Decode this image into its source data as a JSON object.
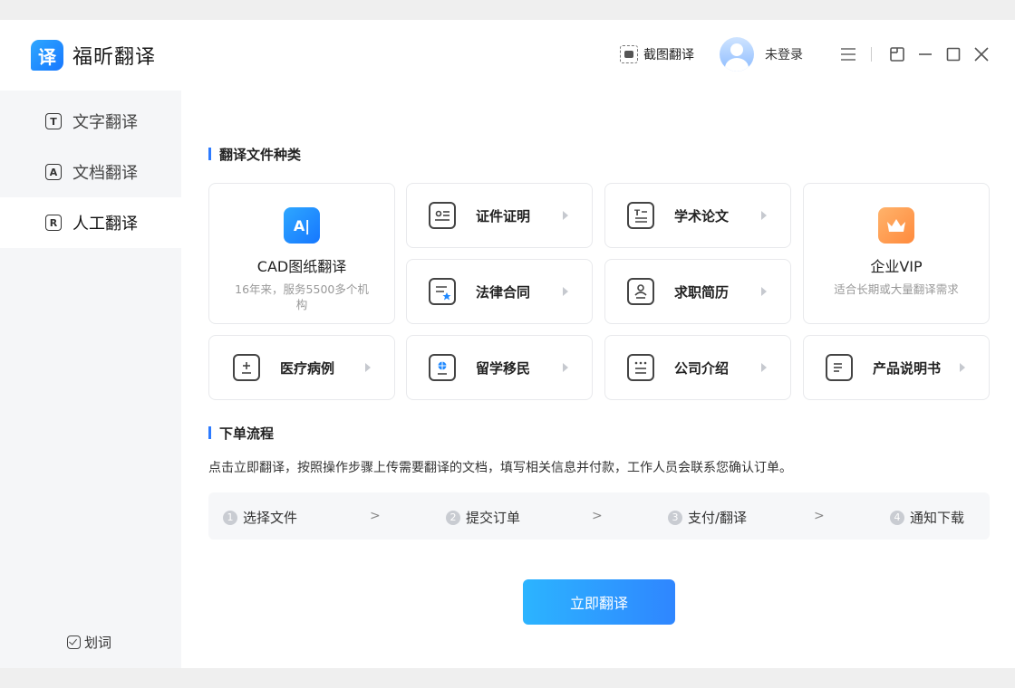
{
  "app": {
    "logo_glyph": "译",
    "title": "福昕翻译",
    "brand_color": "#1677ff"
  },
  "header": {
    "screenshot_label": "截图翻译",
    "login_label": "未登录"
  },
  "sidebar": {
    "items": [
      {
        "icon_glyph": "T",
        "label": "文字翻译",
        "icon": "text-icon"
      },
      {
        "icon_glyph": "A",
        "label": "文档翻译",
        "icon": "document-icon"
      },
      {
        "icon_glyph": "R",
        "label": "人工翻译",
        "icon": "human-translate-icon",
        "active": true
      }
    ],
    "huaci_label": "划词"
  },
  "section1": {
    "title": "翻译文件种类",
    "cad": {
      "icon_glyph": "A|",
      "title": "CAD图纸翻译",
      "desc": "16年来，服务5500多个机构"
    },
    "vip": {
      "title": "企业VIP",
      "desc": "适合长期或大量翻译需求"
    },
    "cards": [
      {
        "label": "证件证明",
        "icon": "id-card-icon"
      },
      {
        "label": "学术论文",
        "icon": "paper-icon"
      },
      {
        "label": "法律合同",
        "icon": "contract-icon"
      },
      {
        "label": "求职简历",
        "icon": "resume-icon"
      },
      {
        "label": "医疗病例",
        "icon": "medical-icon"
      },
      {
        "label": "留学移民",
        "icon": "passport-icon"
      },
      {
        "label": "公司介绍",
        "icon": "company-icon"
      },
      {
        "label": "产品说明书",
        "icon": "manual-icon"
      }
    ]
  },
  "section2": {
    "title": "下单流程",
    "desc": "点击立即翻译，按照操作步骤上传需要翻译的文档，填写相关信息并付款，工作人员会联系您确认订单。",
    "steps": [
      {
        "num": "1",
        "label": "选择文件"
      },
      {
        "num": "2",
        "label": "提交订单"
      },
      {
        "num": "3",
        "label": "支付/翻译"
      },
      {
        "num": "4",
        "label": "通知下载"
      }
    ],
    "step_separator": ">"
  },
  "cta_label": "立即翻译"
}
